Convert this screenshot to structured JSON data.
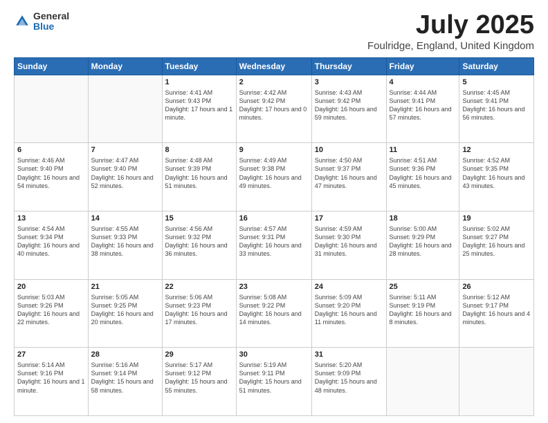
{
  "header": {
    "logo_general": "General",
    "logo_blue": "Blue",
    "title": "July 2025",
    "subtitle": "Foulridge, England, United Kingdom"
  },
  "days_of_week": [
    "Sunday",
    "Monday",
    "Tuesday",
    "Wednesday",
    "Thursday",
    "Friday",
    "Saturday"
  ],
  "weeks": [
    [
      {
        "day": "",
        "info": ""
      },
      {
        "day": "",
        "info": ""
      },
      {
        "day": "1",
        "sunrise": "4:41 AM",
        "sunset": "9:43 PM",
        "daylight": "17 hours and 1 minute."
      },
      {
        "day": "2",
        "sunrise": "4:42 AM",
        "sunset": "9:42 PM",
        "daylight": "17 hours and 0 minutes."
      },
      {
        "day": "3",
        "sunrise": "4:43 AM",
        "sunset": "9:42 PM",
        "daylight": "16 hours and 59 minutes."
      },
      {
        "day": "4",
        "sunrise": "4:44 AM",
        "sunset": "9:41 PM",
        "daylight": "16 hours and 57 minutes."
      },
      {
        "day": "5",
        "sunrise": "4:45 AM",
        "sunset": "9:41 PM",
        "daylight": "16 hours and 56 minutes."
      }
    ],
    [
      {
        "day": "6",
        "sunrise": "4:46 AM",
        "sunset": "9:40 PM",
        "daylight": "16 hours and 54 minutes."
      },
      {
        "day": "7",
        "sunrise": "4:47 AM",
        "sunset": "9:40 PM",
        "daylight": "16 hours and 52 minutes."
      },
      {
        "day": "8",
        "sunrise": "4:48 AM",
        "sunset": "9:39 PM",
        "daylight": "16 hours and 51 minutes."
      },
      {
        "day": "9",
        "sunrise": "4:49 AM",
        "sunset": "9:38 PM",
        "daylight": "16 hours and 49 minutes."
      },
      {
        "day": "10",
        "sunrise": "4:50 AM",
        "sunset": "9:37 PM",
        "daylight": "16 hours and 47 minutes."
      },
      {
        "day": "11",
        "sunrise": "4:51 AM",
        "sunset": "9:36 PM",
        "daylight": "16 hours and 45 minutes."
      },
      {
        "day": "12",
        "sunrise": "4:52 AM",
        "sunset": "9:35 PM",
        "daylight": "16 hours and 43 minutes."
      }
    ],
    [
      {
        "day": "13",
        "sunrise": "4:54 AM",
        "sunset": "9:34 PM",
        "daylight": "16 hours and 40 minutes."
      },
      {
        "day": "14",
        "sunrise": "4:55 AM",
        "sunset": "9:33 PM",
        "daylight": "16 hours and 38 minutes."
      },
      {
        "day": "15",
        "sunrise": "4:56 AM",
        "sunset": "9:32 PM",
        "daylight": "16 hours and 36 minutes."
      },
      {
        "day": "16",
        "sunrise": "4:57 AM",
        "sunset": "9:31 PM",
        "daylight": "16 hours and 33 minutes."
      },
      {
        "day": "17",
        "sunrise": "4:59 AM",
        "sunset": "9:30 PM",
        "daylight": "16 hours and 31 minutes."
      },
      {
        "day": "18",
        "sunrise": "5:00 AM",
        "sunset": "9:29 PM",
        "daylight": "16 hours and 28 minutes."
      },
      {
        "day": "19",
        "sunrise": "5:02 AM",
        "sunset": "9:27 PM",
        "daylight": "16 hours and 25 minutes."
      }
    ],
    [
      {
        "day": "20",
        "sunrise": "5:03 AM",
        "sunset": "9:26 PM",
        "daylight": "16 hours and 22 minutes."
      },
      {
        "day": "21",
        "sunrise": "5:05 AM",
        "sunset": "9:25 PM",
        "daylight": "16 hours and 20 minutes."
      },
      {
        "day": "22",
        "sunrise": "5:06 AM",
        "sunset": "9:23 PM",
        "daylight": "16 hours and 17 minutes."
      },
      {
        "day": "23",
        "sunrise": "5:08 AM",
        "sunset": "9:22 PM",
        "daylight": "16 hours and 14 minutes."
      },
      {
        "day": "24",
        "sunrise": "5:09 AM",
        "sunset": "9:20 PM",
        "daylight": "16 hours and 11 minutes."
      },
      {
        "day": "25",
        "sunrise": "5:11 AM",
        "sunset": "9:19 PM",
        "daylight": "16 hours and 8 minutes."
      },
      {
        "day": "26",
        "sunrise": "5:12 AM",
        "sunset": "9:17 PM",
        "daylight": "16 hours and 4 minutes."
      }
    ],
    [
      {
        "day": "27",
        "sunrise": "5:14 AM",
        "sunset": "9:16 PM",
        "daylight": "16 hours and 1 minute."
      },
      {
        "day": "28",
        "sunrise": "5:16 AM",
        "sunset": "9:14 PM",
        "daylight": "15 hours and 58 minutes."
      },
      {
        "day": "29",
        "sunrise": "5:17 AM",
        "sunset": "9:12 PM",
        "daylight": "15 hours and 55 minutes."
      },
      {
        "day": "30",
        "sunrise": "5:19 AM",
        "sunset": "9:11 PM",
        "daylight": "15 hours and 51 minutes."
      },
      {
        "day": "31",
        "sunrise": "5:20 AM",
        "sunset": "9:09 PM",
        "daylight": "15 hours and 48 minutes."
      },
      {
        "day": "",
        "info": ""
      },
      {
        "day": "",
        "info": ""
      }
    ]
  ]
}
